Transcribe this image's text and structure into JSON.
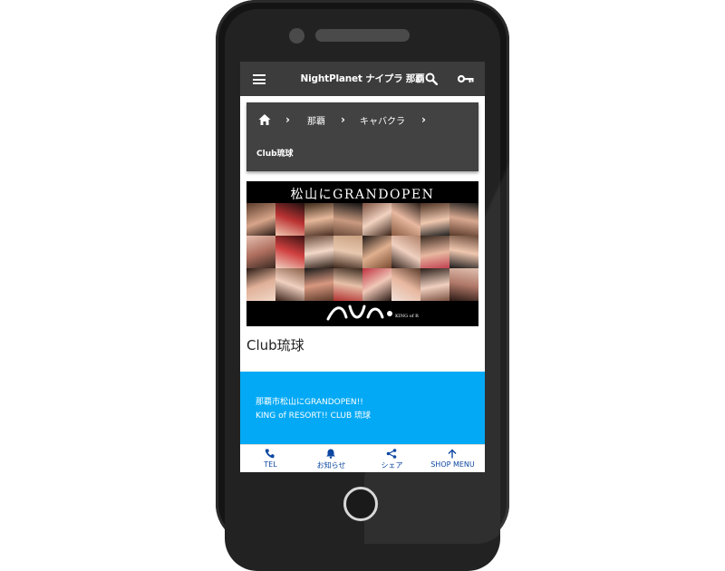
{
  "appbar": {
    "title": "NightPlanet ナイプラ 那覇"
  },
  "breadcrumb": {
    "items": [
      "那覇",
      "キャバクラ"
    ],
    "current": "Club琉球"
  },
  "banner": {
    "headline": "松山にGRANDOPEN",
    "group_text": "琉球ベルグループ"
  },
  "store": {
    "name": "Club琉球"
  },
  "info": {
    "lines": [
      "那覇市松山にGRANDOPEN!!",
      "KING of RESORT!! CLUB 琉球"
    ]
  },
  "bottom_nav": [
    {
      "label": "TEL",
      "icon": "phone-icon"
    },
    {
      "label": "お知らせ",
      "icon": "bell-icon"
    },
    {
      "label": "シェア",
      "icon": "share-icon"
    },
    {
      "label": "SHOP MENU",
      "icon": "arrow-up-icon"
    }
  ],
  "colors": {
    "appbar": "#3c3c3c",
    "breadcrumb": "#424242",
    "accent": "#03a9f4",
    "nav_text": "#0d47a1"
  }
}
